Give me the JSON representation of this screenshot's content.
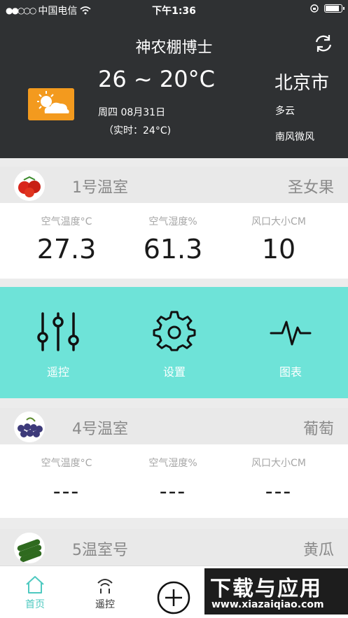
{
  "status_bar": {
    "carrier": "中国电信",
    "time": "下午1:36"
  },
  "header": {
    "title": "神农棚博士",
    "temp_range": "26 ~ 20°C",
    "date": "周四 08月31日",
    "realtime": "（实时：24°C)",
    "city": "北京市",
    "condition": "多云",
    "wind": "南风微风"
  },
  "greenhouses": [
    {
      "name": "1号温室",
      "crop": "圣女果",
      "metrics": [
        {
          "label": "空气温度°C",
          "value": "27.3"
        },
        {
          "label": "空气湿度%",
          "value": "61.3"
        },
        {
          "label": "风口大小CM",
          "value": "10"
        }
      ]
    },
    {
      "name": "4号温室",
      "crop": "葡萄",
      "metrics": [
        {
          "label": "空气温度°C",
          "value": "---"
        },
        {
          "label": "空气湿度%",
          "value": "---"
        },
        {
          "label": "风口大小CM",
          "value": "---"
        }
      ]
    },
    {
      "name": "5温室号",
      "crop": "黄瓜"
    }
  ],
  "actions": [
    {
      "label": "遥控"
    },
    {
      "label": "设置"
    },
    {
      "label": "图表"
    }
  ],
  "tabs": [
    {
      "label": "首页"
    },
    {
      "label": "遥控"
    }
  ],
  "watermark": {
    "big": "下载与应用",
    "small": "www.xiazaiqiao.com"
  },
  "colors": {
    "header_bg": "#2f3133",
    "accent": "#6ee3d8",
    "weather_icon_bg": "#f39a1e",
    "active_tab": "#4ec9c0"
  }
}
